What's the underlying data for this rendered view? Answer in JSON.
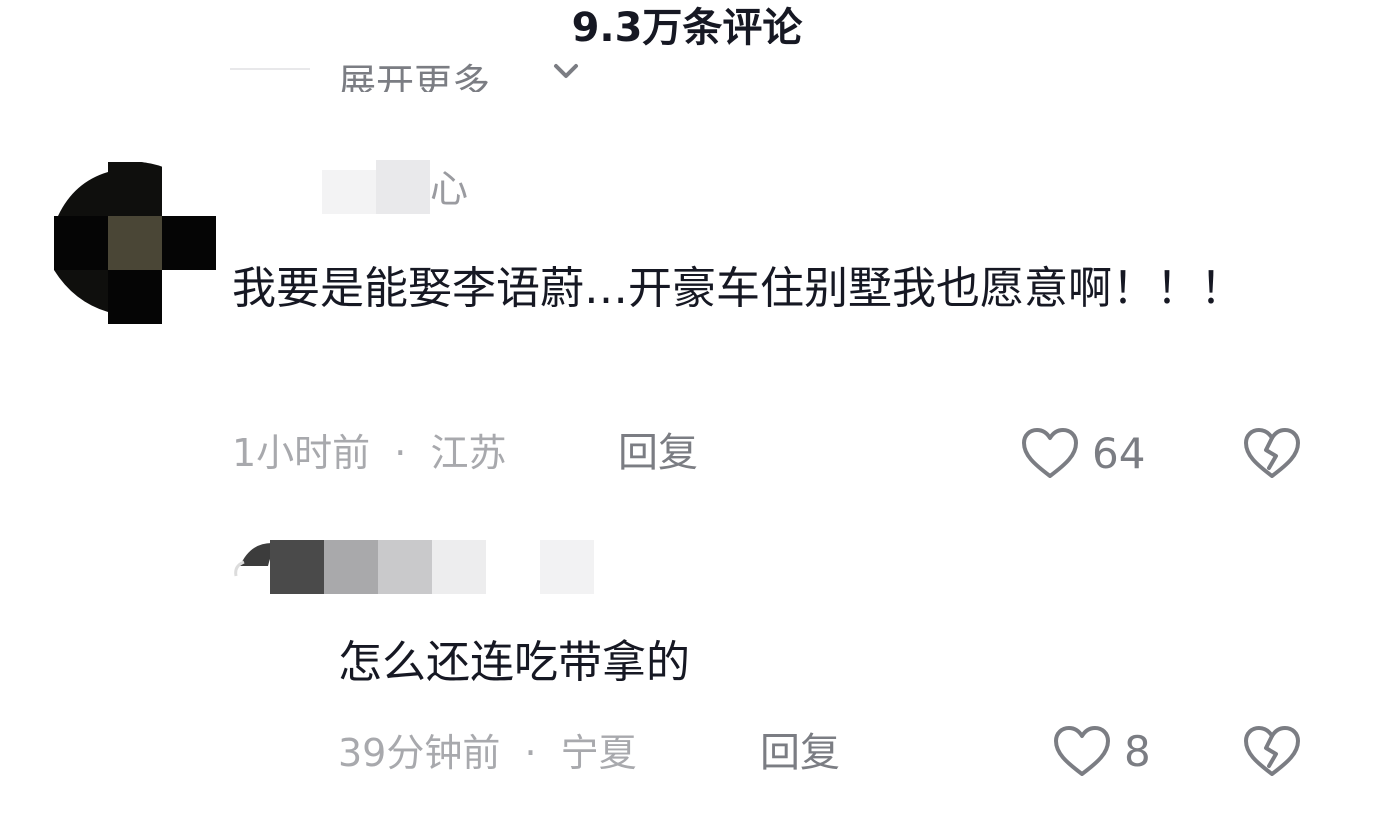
{
  "header": {
    "title": "9.3万条评论"
  },
  "expand": {
    "label": "展开更多",
    "icon": "chevron-down-icon"
  },
  "comments": [
    {
      "username": "心",
      "text": "我要是能娶李语蔚…开豪车住别墅我也愿意啊！！！",
      "time": "1小时前",
      "separator": "·",
      "location": "江苏",
      "reply_label": "回复",
      "likes": "64",
      "like_icon": "heart-outline-icon",
      "dislike_icon": "broken-heart-icon"
    },
    {
      "text": "怎么还连吃带拿的",
      "time": "39分钟前",
      "separator": "·",
      "location": "宁夏",
      "reply_label": "回复",
      "likes": "8",
      "like_icon": "heart-outline-icon",
      "dislike_icon": "broken-heart-icon"
    }
  ],
  "colors": {
    "text_primary": "#161823",
    "text_secondary": "#7b7d83",
    "text_meta": "#a8a9ad",
    "background": "#ffffff"
  }
}
